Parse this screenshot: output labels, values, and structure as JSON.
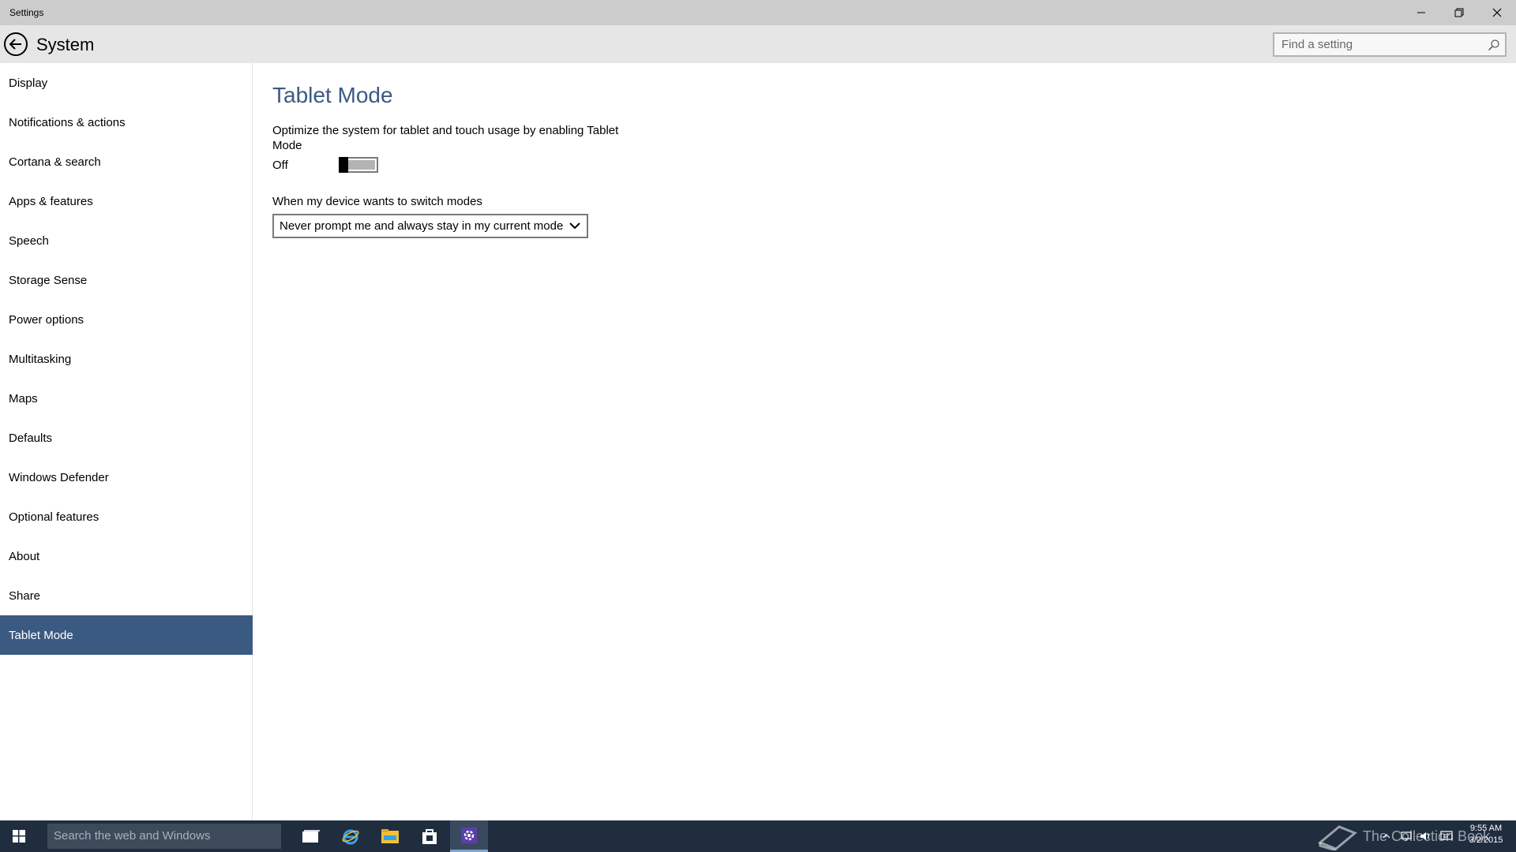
{
  "window": {
    "title": "Settings",
    "controls": {
      "minimize_icon": "minimize-icon",
      "maximize_icon": "restore-icon",
      "close_icon": "close-icon"
    }
  },
  "header": {
    "back_icon": "back-arrow-icon",
    "title": "System",
    "search_placeholder": "Find a setting",
    "search_value": ""
  },
  "sidebar": {
    "items": [
      {
        "label": "Display"
      },
      {
        "label": "Notifications & actions"
      },
      {
        "label": "Cortana & search"
      },
      {
        "label": "Apps & features"
      },
      {
        "label": "Speech"
      },
      {
        "label": "Storage Sense"
      },
      {
        "label": "Power options"
      },
      {
        "label": "Multitasking"
      },
      {
        "label": "Maps"
      },
      {
        "label": "Defaults"
      },
      {
        "label": "Windows Defender"
      },
      {
        "label": "Optional features"
      },
      {
        "label": "About"
      },
      {
        "label": "Share"
      },
      {
        "label": "Tablet Mode"
      }
    ],
    "selected": "Tablet Mode"
  },
  "main": {
    "title": "Tablet Mode",
    "description": "Optimize the system for tablet and touch usage by enabling Tablet Mode",
    "toggle": {
      "state_label": "Off",
      "on": false
    },
    "switch_label": "When my device wants to switch modes",
    "switch_dropdown": {
      "selected": "Never prompt me and always stay in my current mode"
    }
  },
  "taskbar": {
    "search_placeholder": "Search the web and Windows",
    "apps": [
      "task-view-icon",
      "internet-explorer-icon",
      "file-explorer-icon",
      "store-icon",
      "settings-icon"
    ],
    "active_app": "settings-icon",
    "watermark": "The Collection Book",
    "time": "9:55 AM",
    "date": "3/2/2015"
  },
  "colors": {
    "accent": "#3b5a82",
    "title_accent": "#3a5a82",
    "titlebar": "#cccccc",
    "header": "#e6e6e6",
    "taskbar": "#1f2d3f"
  }
}
